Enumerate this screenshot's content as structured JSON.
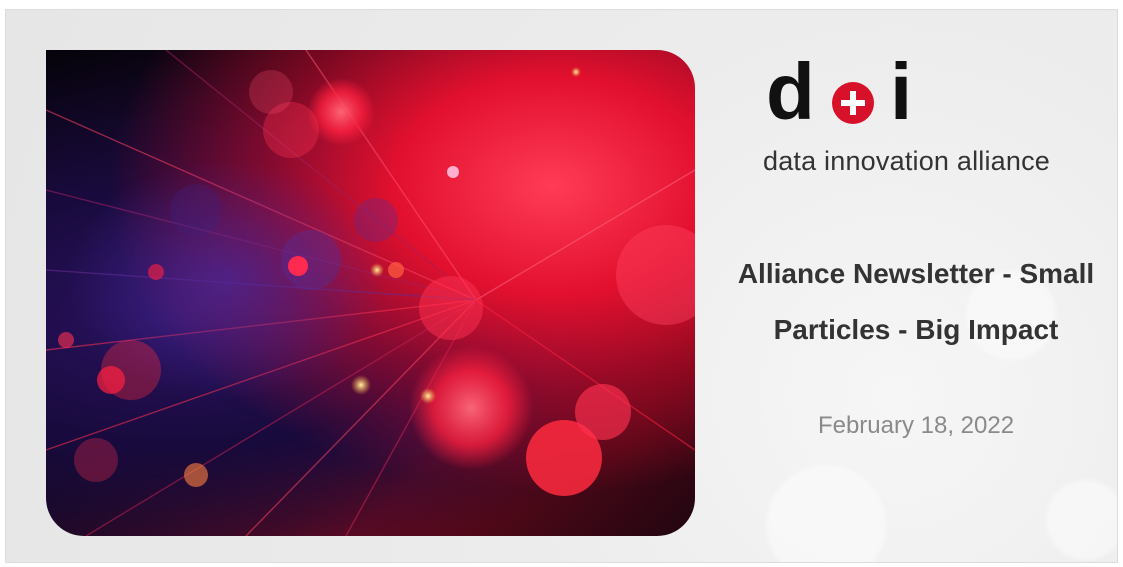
{
  "logo": {
    "letters": [
      "d",
      "i"
    ],
    "brand_color": "#d8112a",
    "icon": "swiss-cross-icon"
  },
  "tagline": "data innovation alliance",
  "post": {
    "title": "Alliance Newsletter - Small Particles - Big Impact",
    "date": "February 18, 2022"
  },
  "colors": {
    "title": "#333333",
    "date": "#8a8a8a",
    "accent_red": "#d8112a"
  }
}
